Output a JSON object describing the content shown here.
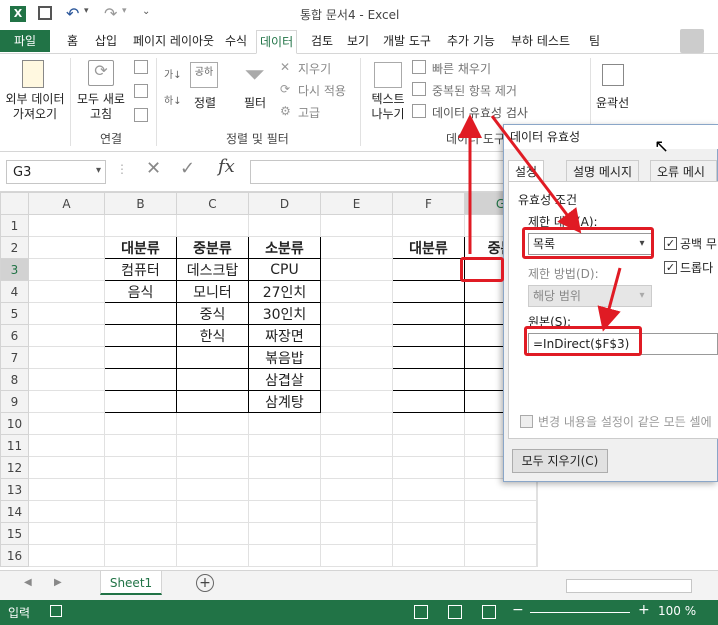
{
  "window": {
    "title": "통합 문서4 - Excel"
  },
  "menu_tabs": [
    "파일",
    "홈",
    "삽입",
    "페이지 레이아웃",
    "수식",
    "데이터",
    "검토",
    "보기",
    "개발 도구",
    "추가 기능",
    "부하 테스트",
    "팀"
  ],
  "ribbon": {
    "external_data": "외부 데이터\n가져오기",
    "refresh_all": "모두 새로\n고침",
    "group_connections": "연결",
    "sort": "정렬",
    "filter": "필터",
    "clear": "지우기",
    "reapply": "다시 적용",
    "advanced": "고급",
    "group_sort_filter": "정렬 및 필터",
    "text_to_columns": "텍스트\n나누기",
    "flash_fill": "빠른 채우기",
    "remove_duplicates": "중복된 항목 제거",
    "data_validation": "데이터 유효성 검사",
    "group_data_tools": "데이터 도구",
    "outline": "윤곽선"
  },
  "formula_bar": {
    "name_box": "G3",
    "formula": ""
  },
  "columns": [
    "A",
    "B",
    "C",
    "D",
    "E",
    "F",
    "G"
  ],
  "rows": [
    "1",
    "2",
    "3",
    "4",
    "5",
    "6",
    "7",
    "8",
    "9",
    "10",
    "11",
    "12",
    "13",
    "14",
    "15",
    "16"
  ],
  "cells": {
    "B2": "대분류",
    "C2": "중분류",
    "D2": "소분류",
    "B3": "컴퓨터",
    "C3": "데스크탑",
    "D3": "CPU",
    "B4": "음식",
    "C4": "모니터",
    "D4": "27인치",
    "C5": "중식",
    "D5": "30인치",
    "C6": "한식",
    "D6": "짜장면",
    "D7": "볶음밥",
    "D8": "삼겹살",
    "D9": "삼계탕",
    "F2": "대분류",
    "G2": "중분"
  },
  "sheet_tab": "Sheet1",
  "status": {
    "mode": "입력",
    "zoom": "100 %"
  },
  "dialog": {
    "title": "데이터 유효성",
    "tabs": [
      "설정",
      "설명 메시지",
      "오류 메시지"
    ],
    "section": "유효성 조건",
    "allow_label": "제한 대상(A):",
    "allow_value": "목록",
    "ignore_blank": "공백 무",
    "in_cell_dropdown": "드롭다",
    "data_label": "제한 방법(D):",
    "data_value": "해당 범위",
    "source_label": "원본(S):",
    "source_value": "=InDirect($F$3)",
    "apply_all": "변경 내용을 설정이 같은 모든 셀에",
    "clear_all": "모두 지우기(C)"
  },
  "colors": {
    "accent": "#217346",
    "highlight": "#e01b24"
  }
}
